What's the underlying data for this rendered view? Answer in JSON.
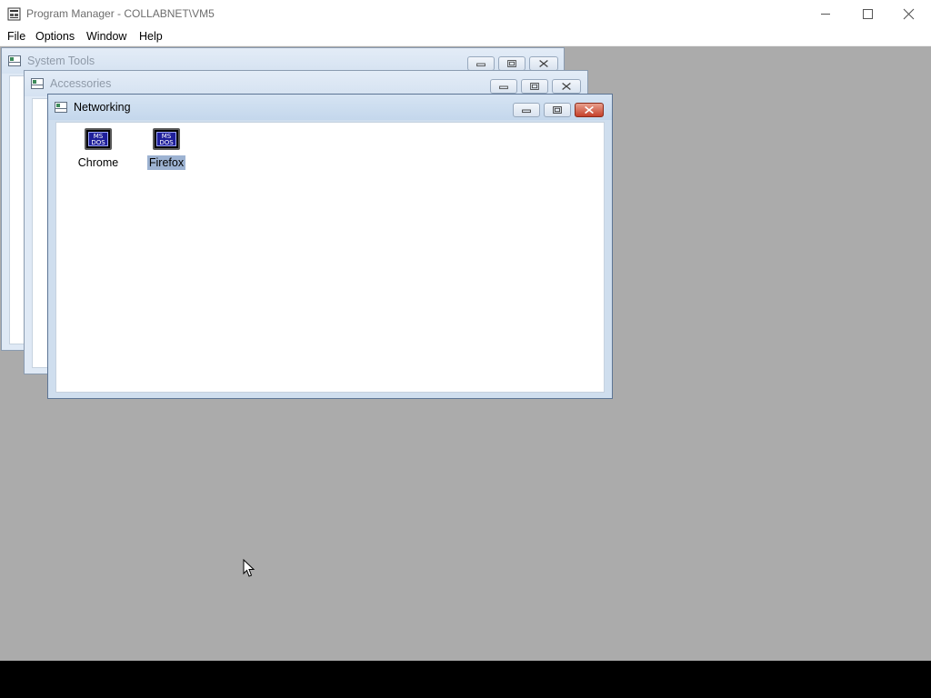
{
  "app": {
    "title": "Program Manager - COLLABNET\\VM5",
    "icon": "program-manager-icon"
  },
  "caption_buttons": [
    "minimize",
    "maximize",
    "close"
  ],
  "menu": {
    "items": [
      {
        "label": "File"
      },
      {
        "label": "Options"
      },
      {
        "label": "Window"
      },
      {
        "label": "Help"
      }
    ]
  },
  "groups": [
    {
      "title": "System Tools",
      "active": false
    },
    {
      "title": "Accessories",
      "active": false
    },
    {
      "title": "Networking",
      "active": true,
      "programs": [
        {
          "label": "Chrome",
          "icon": "ms-dos-icon",
          "icon_text": "MS\nDOS",
          "selected": false
        },
        {
          "label": "Firefox",
          "icon": "ms-dos-icon",
          "icon_text": "MS\nDOS",
          "selected": true
        }
      ]
    }
  ],
  "colors": {
    "desktop": "#ababab",
    "selection": "#9db3d2",
    "close_active": "#c5402a"
  }
}
